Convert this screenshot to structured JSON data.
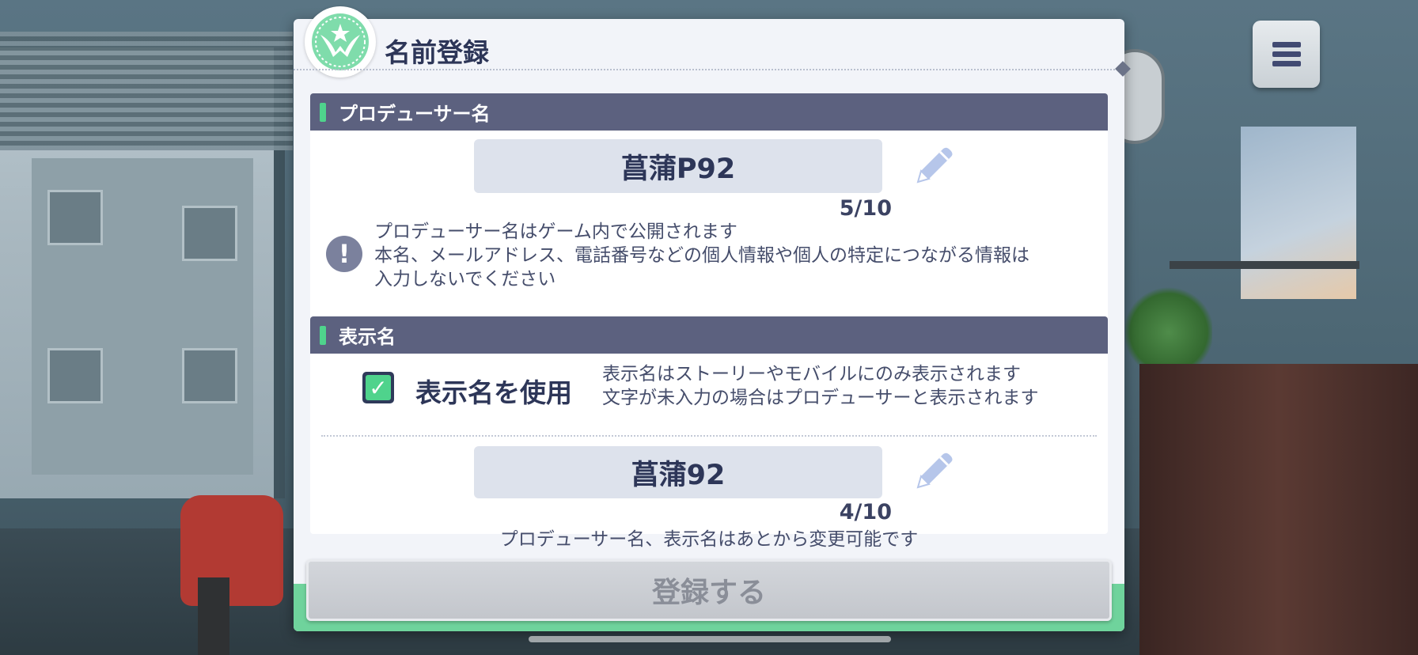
{
  "dialog": {
    "title": "名前登録",
    "emblem_icon": "wing-star-emblem-icon"
  },
  "producer_section": {
    "header": "プロデューサー名",
    "name_value": "菖蒲P92",
    "char_count": "5/10",
    "notice_icon": "exclamation-icon",
    "notice_lines": [
      "プロデューサー名はゲーム内で公開されます",
      "本名、メールアドレス、電話番号などの個人情報や個人の特定につながる情報は",
      "入力しないでください"
    ]
  },
  "display_section": {
    "header": "表示名",
    "use_checkbox_label": "表示名を使用",
    "use_checked": true,
    "info_lines": [
      "表示名はストーリーやモバイルにのみ表示されます",
      "文字が未入力の場合はプロデューサーと表示されます"
    ],
    "name_value": "菖蒲92",
    "char_count": "4/10"
  },
  "footer_note": "プロデューサー名、表示名はあとから変更可能です",
  "register_button": "登録する",
  "menu_icon": "hamburger-menu-icon",
  "colors": {
    "accent_green": "#4fd38c",
    "header_bg": "#5c617f",
    "text_dark": "#2d3658"
  }
}
